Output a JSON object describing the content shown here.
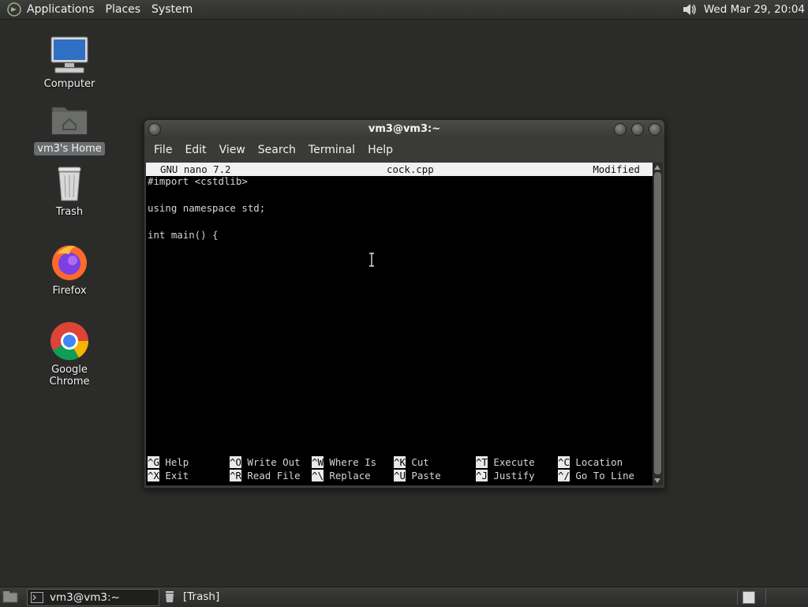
{
  "top_panel": {
    "menus": [
      "Applications",
      "Places",
      "System"
    ],
    "clock": "Wed Mar 29, 20:04",
    "icons": [
      "gnome-foot-icon",
      "volume-icon"
    ]
  },
  "desktop": {
    "icons": [
      {
        "label": "Computer",
        "icon": "computer-icon"
      },
      {
        "label": "vm3's Home",
        "icon": "home-folder-icon",
        "selected": true
      },
      {
        "label": "Trash",
        "icon": "trash-icon"
      },
      {
        "label": "Firefox",
        "icon": "firefox-icon"
      },
      {
        "label": "Google Chrome",
        "icon": "chrome-icon"
      }
    ]
  },
  "window": {
    "title": "vm3@vm3:~",
    "menu": [
      "File",
      "Edit",
      "View",
      "Search",
      "Terminal",
      "Help"
    ]
  },
  "nano": {
    "version": "GNU nano 7.2",
    "filename": "cock.cpp",
    "status": "Modified",
    "lines": [
      "#import <cstdlib>",
      "",
      "using namespace std;",
      "",
      "int main() {"
    ],
    "shortcuts_row1": [
      {
        "key": "^G",
        "label": "Help"
      },
      {
        "key": "^O",
        "label": "Write Out"
      },
      {
        "key": "^W",
        "label": "Where Is"
      },
      {
        "key": "^K",
        "label": "Cut"
      },
      {
        "key": "^T",
        "label": "Execute"
      },
      {
        "key": "^C",
        "label": "Location"
      }
    ],
    "shortcuts_row2": [
      {
        "key": "^X",
        "label": "Exit"
      },
      {
        "key": "^R",
        "label": "Read File"
      },
      {
        "key": "^\\",
        "label": "Replace"
      },
      {
        "key": "^U",
        "label": "Paste"
      },
      {
        "key": "^J",
        "label": "Justify"
      },
      {
        "key": "^/",
        "label": "Go To Line"
      }
    ]
  },
  "taskbar": {
    "tasks": [
      {
        "label": "vm3@vm3:~",
        "icon": "terminal-icon",
        "active": true
      },
      {
        "label": "[Trash]",
        "icon": "trash-icon",
        "active": false
      }
    ]
  },
  "colors": {
    "desktop_bg": "#2b2c2a",
    "panel": "#353633",
    "terminal_bg": "#000000"
  }
}
